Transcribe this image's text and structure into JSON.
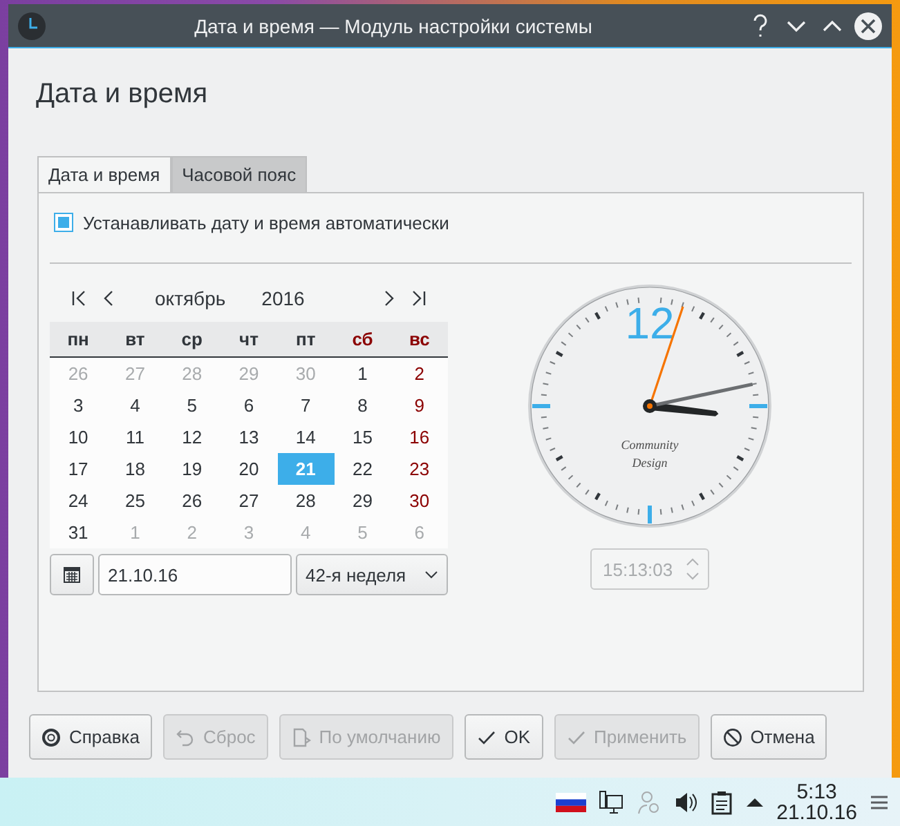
{
  "window": {
    "title": "Дата и время — Модуль настройки системы"
  },
  "heading": "Дата и время",
  "tabs": [
    {
      "label": "Дата и время",
      "selected": true
    },
    {
      "label": "Часовой пояс",
      "selected": false
    }
  ],
  "auto_set": {
    "label": "Устанавливать дату и время автоматически",
    "checked": true
  },
  "calendar": {
    "month": "октябрь",
    "year": "2016",
    "weekdays": [
      {
        "label": "пн",
        "weekend": false,
        "holiday": false
      },
      {
        "label": "вт",
        "weekend": false,
        "holiday": false
      },
      {
        "label": "ср",
        "weekend": false,
        "holiday": false
      },
      {
        "label": "чт",
        "weekend": false,
        "holiday": false
      },
      {
        "label": "пт",
        "weekend": false,
        "holiday": false
      },
      {
        "label": "сб",
        "weekend": true,
        "holiday": false
      },
      {
        "label": "вс",
        "weekend": true,
        "holiday": true
      }
    ],
    "weeks": [
      [
        {
          "d": "26",
          "muted": true,
          "selected": false
        },
        {
          "d": "27",
          "muted": true,
          "selected": false
        },
        {
          "d": "28",
          "muted": true,
          "selected": false
        },
        {
          "d": "29",
          "muted": true,
          "selected": false
        },
        {
          "d": "30",
          "muted": true,
          "selected": false
        },
        {
          "d": "1",
          "muted": false,
          "selected": false
        },
        {
          "d": "2",
          "muted": false,
          "selected": false
        }
      ],
      [
        {
          "d": "3",
          "muted": false,
          "selected": false
        },
        {
          "d": "4",
          "muted": false,
          "selected": false
        },
        {
          "d": "5",
          "muted": false,
          "selected": false
        },
        {
          "d": "6",
          "muted": false,
          "selected": false
        },
        {
          "d": "7",
          "muted": false,
          "selected": false
        },
        {
          "d": "8",
          "muted": false,
          "selected": false
        },
        {
          "d": "9",
          "muted": false,
          "selected": false
        }
      ],
      [
        {
          "d": "10",
          "muted": false,
          "selected": false
        },
        {
          "d": "11",
          "muted": false,
          "selected": false
        },
        {
          "d": "12",
          "muted": false,
          "selected": false
        },
        {
          "d": "13",
          "muted": false,
          "selected": false
        },
        {
          "d": "14",
          "muted": false,
          "selected": false
        },
        {
          "d": "15",
          "muted": false,
          "selected": false
        },
        {
          "d": "16",
          "muted": false,
          "selected": false
        }
      ],
      [
        {
          "d": "17",
          "muted": false,
          "selected": false
        },
        {
          "d": "18",
          "muted": false,
          "selected": false
        },
        {
          "d": "19",
          "muted": false,
          "selected": false
        },
        {
          "d": "20",
          "muted": false,
          "selected": false
        },
        {
          "d": "21",
          "muted": false,
          "selected": true
        },
        {
          "d": "22",
          "muted": false,
          "selected": false
        },
        {
          "d": "23",
          "muted": false,
          "selected": false
        }
      ],
      [
        {
          "d": "24",
          "muted": false,
          "selected": false
        },
        {
          "d": "25",
          "muted": false,
          "selected": false
        },
        {
          "d": "26",
          "muted": false,
          "selected": false
        },
        {
          "d": "27",
          "muted": false,
          "selected": false
        },
        {
          "d": "28",
          "muted": false,
          "selected": false
        },
        {
          "d": "29",
          "muted": false,
          "selected": false
        },
        {
          "d": "30",
          "muted": false,
          "selected": false
        }
      ],
      [
        {
          "d": "31",
          "muted": false,
          "selected": false
        },
        {
          "d": "1",
          "muted": true,
          "selected": false
        },
        {
          "d": "2",
          "muted": true,
          "selected": false
        },
        {
          "d": "3",
          "muted": true,
          "selected": false
        },
        {
          "d": "4",
          "muted": true,
          "selected": false
        },
        {
          "d": "5",
          "muted": true,
          "selected": false
        },
        {
          "d": "6",
          "muted": true,
          "selected": false
        }
      ]
    ],
    "date_value": "21.10.16",
    "week": "42-я неделя"
  },
  "clock": {
    "numeral": "12",
    "brand": [
      "Community",
      "Design"
    ],
    "time": "15:13:03",
    "time_disabled": true
  },
  "buttons": [
    {
      "label": "Справка",
      "kind": "help",
      "disabled": false
    },
    {
      "label": "Сброс",
      "kind": "reset",
      "disabled": true
    },
    {
      "label": "По умолчанию",
      "kind": "defaults",
      "disabled": true
    },
    {
      "label": "OK",
      "kind": "ok",
      "disabled": false
    },
    {
      "label": "Применить",
      "kind": "apply",
      "disabled": true
    },
    {
      "label": "Отмена",
      "kind": "cancel",
      "disabled": false
    }
  ],
  "taskbar": {
    "time": "5:13",
    "date": "21.10.16"
  }
}
